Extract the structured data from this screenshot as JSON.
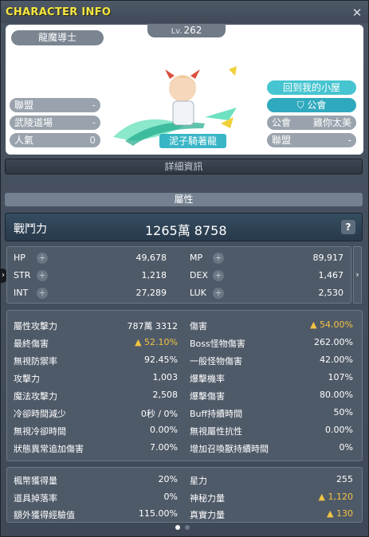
{
  "window": {
    "title": "CHARACTER INFO",
    "close_label": "✕"
  },
  "profile": {
    "name": "龍魔導士",
    "level_prefix": "Lv.",
    "level": "262",
    "character_name": "泥子騎著龍",
    "left_rows": [
      {
        "label": "聯盟",
        "value": "-"
      },
      {
        "label": "武陵道場",
        "value": "-"
      },
      {
        "label": "人氣",
        "value": "0"
      }
    ],
    "home_button": "回到我的小屋",
    "guild_button": "公會",
    "right_rows": [
      {
        "label": "公會",
        "value": "雞你太美"
      },
      {
        "label": "聯盟",
        "value": "-"
      }
    ]
  },
  "detail_button": "詳細資訊",
  "attributes_header": "屬性",
  "power": {
    "label": "戰鬥力",
    "value": "1265萬 8758",
    "help": "?"
  },
  "base_stats": [
    {
      "label": "HP",
      "value": "49,678"
    },
    {
      "label": "MP",
      "value": "89,917"
    },
    {
      "label": "STR",
      "value": "1,218"
    },
    {
      "label": "DEX",
      "value": "1,467"
    },
    {
      "label": "INT",
      "value": "27,289"
    },
    {
      "label": "LUK",
      "value": "2,530"
    }
  ],
  "detail_stats": [
    {
      "label": "屬性攻擊力",
      "value": "787萬 3312",
      "up": false
    },
    {
      "label": "傷害",
      "value": "▲ 54.00%",
      "up": true
    },
    {
      "label": "最終傷害",
      "value": "▲ 52.10%",
      "up": true
    },
    {
      "label": "Boss怪物傷害",
      "value": "262.00%",
      "up": false
    },
    {
      "label": "無視防禦率",
      "value": "92.45%",
      "up": false
    },
    {
      "label": "一般怪物傷害",
      "value": "42.00%",
      "up": false
    },
    {
      "label": "攻擊力",
      "value": "1,003",
      "up": false
    },
    {
      "label": "爆擊機率",
      "value": "107%",
      "up": false
    },
    {
      "label": "魔法攻擊力",
      "value": "2,508",
      "up": false
    },
    {
      "label": "爆擊傷害",
      "value": "80.00%",
      "up": false
    },
    {
      "label": "冷卻時間減少",
      "value": "0秒 / 0%",
      "up": false
    },
    {
      "label": "Buff持續時間",
      "value": "50%",
      "up": false
    },
    {
      "label": "無視冷卻時間",
      "value": "0.00%",
      "up": false
    },
    {
      "label": "無視屬性抗性",
      "value": "0.00%",
      "up": false
    },
    {
      "label": "狀態異常追加傷害",
      "value": "7.00%",
      "up": false
    },
    {
      "label": "增加召喚獸持續時間",
      "value": "0%",
      "up": false
    }
  ],
  "extra_stats": [
    {
      "label": "楓幣獲得量",
      "value": "20%",
      "up": false
    },
    {
      "label": "星力",
      "value": "255",
      "up": false
    },
    {
      "label": "道具掉落率",
      "value": "0%",
      "up": false
    },
    {
      "label": "神秘力量",
      "value": "▲ 1,120",
      "up": true
    },
    {
      "label": "額外獲得經驗值",
      "value": "115.00%",
      "up": false
    },
    {
      "label": "真實力量",
      "value": "▲ 130",
      "up": true
    }
  ],
  "colors": {
    "title": "#f6e642",
    "accent_teal": "#46c4d0",
    "buff_yellow": "#f2c343",
    "dot_active": "#ffffff",
    "dot_inactive": "#6d7886"
  },
  "icons": {
    "plus": "+",
    "right_arrow": "›",
    "left_arrow": "›",
    "guild_icon": "shield-icon"
  }
}
